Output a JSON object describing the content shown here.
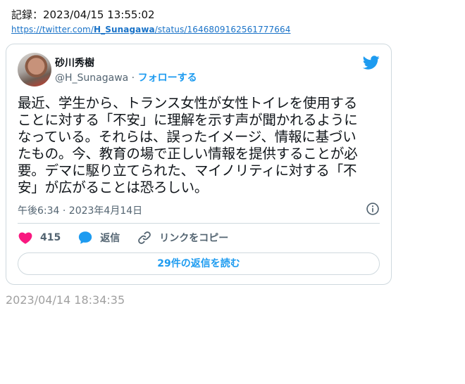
{
  "record": {
    "label": "記録：2023/04/15 13:55:02",
    "url_prefix": "https://twitter.com/",
    "url_user": "H_Sunagawa",
    "url_suffix": "/status/1646809162561777664"
  },
  "tweet": {
    "author_name": "砂川秀樹",
    "handle": "@H_Sunagawa",
    "separator": " · ",
    "follow_label": "フォローする",
    "text": "最近、学生から、トランス女性が女性トイレを使用する\nことに対する「不安」に理解を示す声が聞かれるように\nなっている。それらは、誤ったイメージ、情報に基づい\nたもの。今、教育の場で正しい情報を提供することが必\n要。デマに駆り立てられた、マイノリティに対する「不\n安」が広がることは恐ろしい。",
    "timestamp": "午後6:34 · 2023年4月14日",
    "like_count": "415",
    "reply_label": "返信",
    "copy_link_label": "リンクをコピー",
    "read_replies_label": "29件の返信を読む"
  },
  "archive_date": "2023/04/14 18:34:35",
  "colors": {
    "accent": "#1d9bf0",
    "like": "#f91880",
    "muted": "#536471"
  },
  "icons": {
    "brand": "twitter-bird-icon",
    "info": "info-icon",
    "like": "heart-icon",
    "reply": "speech-bubble-icon",
    "link": "link-icon"
  }
}
